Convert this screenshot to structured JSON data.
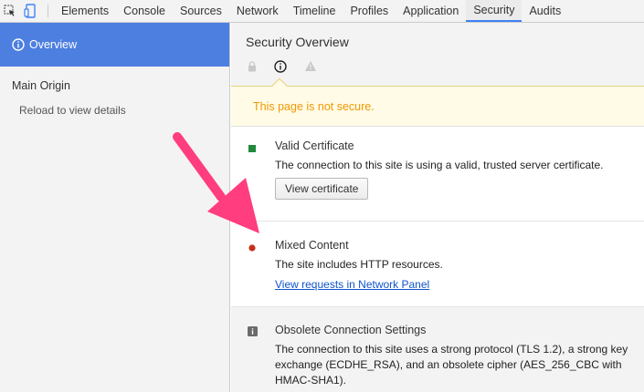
{
  "toolbar": {
    "tabs": [
      {
        "label": "Elements",
        "active": false
      },
      {
        "label": "Console",
        "active": false
      },
      {
        "label": "Sources",
        "active": false
      },
      {
        "label": "Network",
        "active": false
      },
      {
        "label": "Timeline",
        "active": false
      },
      {
        "label": "Profiles",
        "active": false
      },
      {
        "label": "Application",
        "active": false
      },
      {
        "label": "Security",
        "active": true
      },
      {
        "label": "Audits",
        "active": false
      }
    ]
  },
  "sidebar": {
    "overview_label": "Overview",
    "main_origin_label": "Main Origin",
    "reload_hint": "Reload to view details"
  },
  "main": {
    "title": "Security Overview",
    "summary_icons": [
      "lock-icon",
      "info-icon",
      "warning-icon"
    ],
    "banner_text": "This page is not secure.",
    "sections": [
      {
        "status": "secure",
        "title": "Valid Certificate",
        "description": "The connection to this site is using a valid, trusted server certificate.",
        "button_label": "View certificate"
      },
      {
        "status": "insecure",
        "title": "Mixed Content",
        "description": "The site includes HTTP resources.",
        "link_label": "View requests in Network Panel"
      },
      {
        "status": "info",
        "title": "Obsolete Connection Settings",
        "description": "The connection to this site uses a strong protocol (TLS 1.2), a strong key exchange (ECDHE_RSA), and an obsolete cipher (AES_256_CBC with HMAC-SHA1)."
      }
    ]
  },
  "colors": {
    "accent": "#4d7fe0",
    "tab_underline": "#3e82f7",
    "banner_text": "#f29900",
    "banner_bg": "#fffbe6",
    "secure": "#1e8a3a",
    "insecure": "#c5301b",
    "info": "#6b6b6b",
    "link": "#1155cc",
    "annotation_arrow": "#ff3d7f"
  }
}
